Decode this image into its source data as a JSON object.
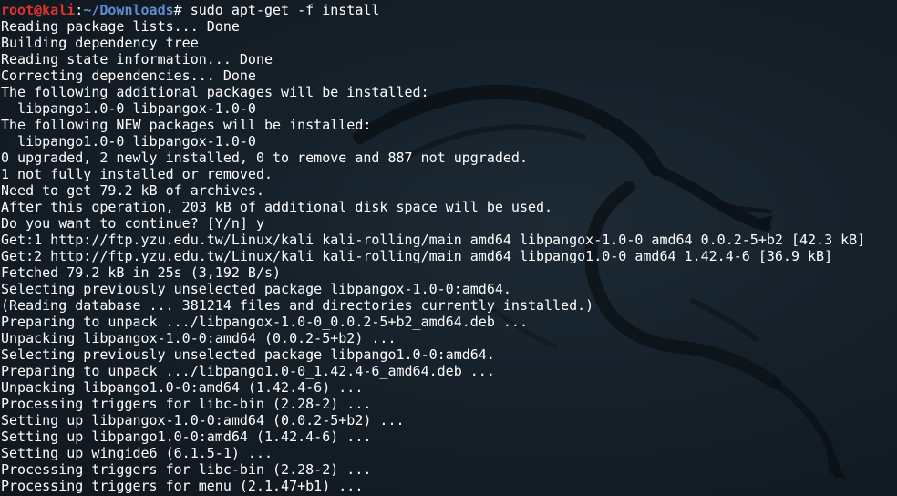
{
  "prompt": {
    "user": "root",
    "at": "@",
    "host": "kali",
    "colon": ":",
    "path": "~/Downloads",
    "symbol": "#",
    "command": " sudo apt-get -f install"
  },
  "output_lines": [
    "Reading package lists... Done",
    "Building dependency tree",
    "Reading state information... Done",
    "Correcting dependencies... Done",
    "The following additional packages will be installed:",
    "  libpango1.0-0 libpangox-1.0-0",
    "The following NEW packages will be installed:",
    "  libpango1.0-0 libpangox-1.0-0",
    "0 upgraded, 2 newly installed, 0 to remove and 887 not upgraded.",
    "1 not fully installed or removed.",
    "Need to get 79.2 kB of archives.",
    "After this operation, 203 kB of additional disk space will be used.",
    "Do you want to continue? [Y/n] y",
    "Get:1 http://ftp.yzu.edu.tw/Linux/kali kali-rolling/main amd64 libpangox-1.0-0 amd64 0.0.2-5+b2 [42.3 kB]",
    "Get:2 http://ftp.yzu.edu.tw/Linux/kali kali-rolling/main amd64 libpango1.0-0 amd64 1.42.4-6 [36.9 kB]",
    "Fetched 79.2 kB in 25s (3,192 B/s)",
    "Selecting previously unselected package libpangox-1.0-0:amd64.",
    "(Reading database ... 381214 files and directories currently installed.)",
    "Preparing to unpack .../libpangox-1.0-0_0.0.2-5+b2_amd64.deb ...",
    "Unpacking libpangox-1.0-0:amd64 (0.0.2-5+b2) ...",
    "Selecting previously unselected package libpango1.0-0:amd64.",
    "Preparing to unpack .../libpango1.0-0_1.42.4-6_amd64.deb ...",
    "Unpacking libpango1.0-0:amd64 (1.42.4-6) ...",
    "Processing triggers for libc-bin (2.28-2) ...",
    "Setting up libpangox-1.0-0:amd64 (0.0.2-5+b2) ...",
    "Setting up libpango1.0-0:amd64 (1.42.4-6) ...",
    "Setting up wingide6 (6.1.5-1) ...",
    "Processing triggers for libc-bin (2.28-2) ...",
    "Processing triggers for menu (2.1.47+b1) ..."
  ],
  "colors": {
    "background": "#152029",
    "text": "#ffffff",
    "prompt_user_host": "#e0322e",
    "prompt_path": "#5f8cd3",
    "wallpaper_dragon": "#0c1318"
  },
  "icons": {
    "wallpaper": "kali-dragon-icon"
  }
}
